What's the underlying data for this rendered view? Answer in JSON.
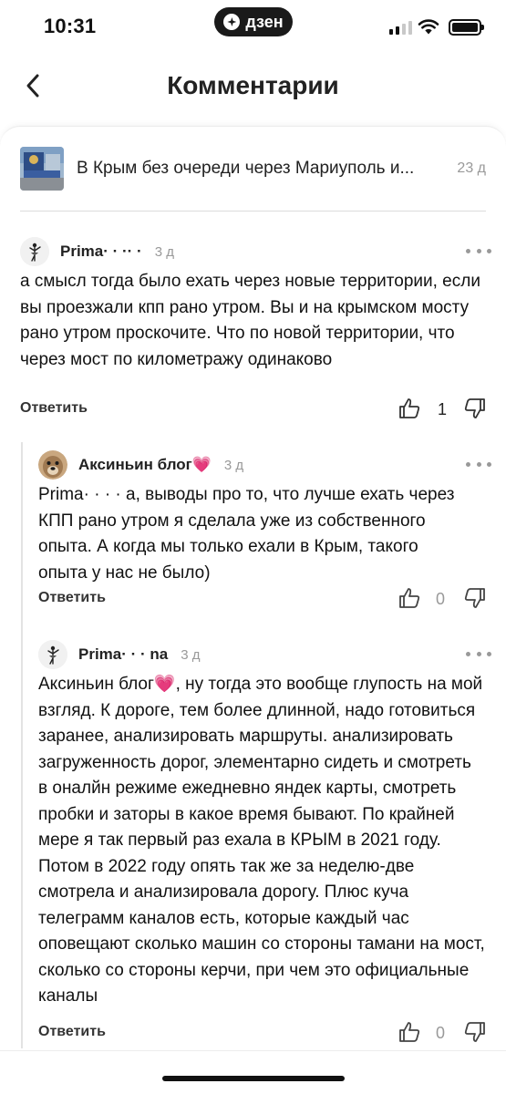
{
  "status_bar": {
    "time": "10:31",
    "app_badge": "дзен"
  },
  "nav": {
    "title": "Комментарии"
  },
  "article": {
    "title": "В Крым без очереди через Мариуполь и...",
    "date": "23 д"
  },
  "comments": [
    {
      "author": "Prima· · ·· ·",
      "time": "3 д",
      "text": "а смысл тогда было ехать через новые территории, если вы проезжали кпп рано утром. Вы и на крымском мосту рано утром проскочите. Что по новой территории, что через мост по километражу одинаково",
      "reply_label": "Ответить",
      "likes": "1"
    },
    {
      "author": "Аксиньин блог💗",
      "time": "3 д",
      "text": "Prima· · · · a, выводы про то, что лучше ехать через КПП рано утром я сделала уже из собственного опыта. А когда мы только ехали в Крым, такого опыта у нас не было)",
      "reply_label": "Ответить",
      "likes": "0"
    },
    {
      "author": "Prima· · · na",
      "time": "3 д",
      "text": "Аксиньин блог💗, ну тогда это вообще глупость на мой взгляд. К дороге, тем более длинной, надо готовиться заранее, анализировать маршруты. анализировать загруженность дорог, элементарно сидеть и смотреть в оналйн режиме ежедневно яндек карты, смотреть пробки и заторы в какое время бывают. По крайней мере я так первый раз ехала в КРЫМ в 2021 году. Потом в 2022 году опять так же за неделю-две смотрела и анализировала дорогу. Плюс куча телеграмм каналов есть, которые каждый час оповещают сколько машин со стороны тамани на мост, сколько со стороны керчи, при чем это официальные каналы",
      "reply_label": "Ответить",
      "likes": "0"
    }
  ]
}
